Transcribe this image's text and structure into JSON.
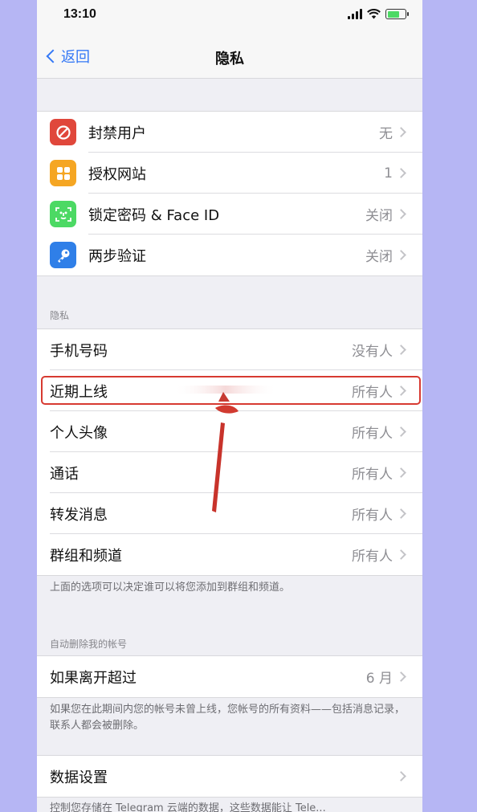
{
  "status_bar": {
    "time": "13:10"
  },
  "nav": {
    "back_label": "返回",
    "title": "隐私"
  },
  "top_group": [
    {
      "label": "封禁用户",
      "value": "无",
      "icon": "block-icon",
      "color": "#e0473b"
    },
    {
      "label": "授权网站",
      "value": "1",
      "icon": "grid-icon",
      "color": "#f5a623"
    },
    {
      "label": "锁定密码 & Face ID",
      "value": "关闭",
      "icon": "face-id-icon",
      "color": "#4cd964"
    },
    {
      "label": "两步验证",
      "value": "关闭",
      "icon": "key-icon",
      "color": "#2f7fe8"
    }
  ],
  "privacy_section": {
    "header": "隐私",
    "items": [
      {
        "label": "手机号码",
        "value": "没有人"
      },
      {
        "label": "近期上线",
        "value": "所有人"
      },
      {
        "label": "个人头像",
        "value": "所有人"
      },
      {
        "label": "通话",
        "value": "所有人"
      },
      {
        "label": "转发消息",
        "value": "所有人"
      },
      {
        "label": "群组和频道",
        "value": "所有人"
      }
    ],
    "footer": "上面的选项可以决定谁可以将您添加到群组和频道。"
  },
  "auto_delete_section": {
    "header": "自动删除我的帐号",
    "item": {
      "label": "如果离开超过",
      "value": "6 月"
    },
    "footer": "如果您在此期间内您的帐号未曾上线，您帐号的所有资料——包括消息记录，联系人都会被删除。"
  },
  "data_section": {
    "item": {
      "label": "数据设置"
    },
    "footer": "控制您存储在 Telegram 云端的数据，这些数据能让 Tele..."
  },
  "colors": {
    "accent": "#3478f6",
    "highlight": "#d73a31",
    "background": "#b6b6f4"
  }
}
